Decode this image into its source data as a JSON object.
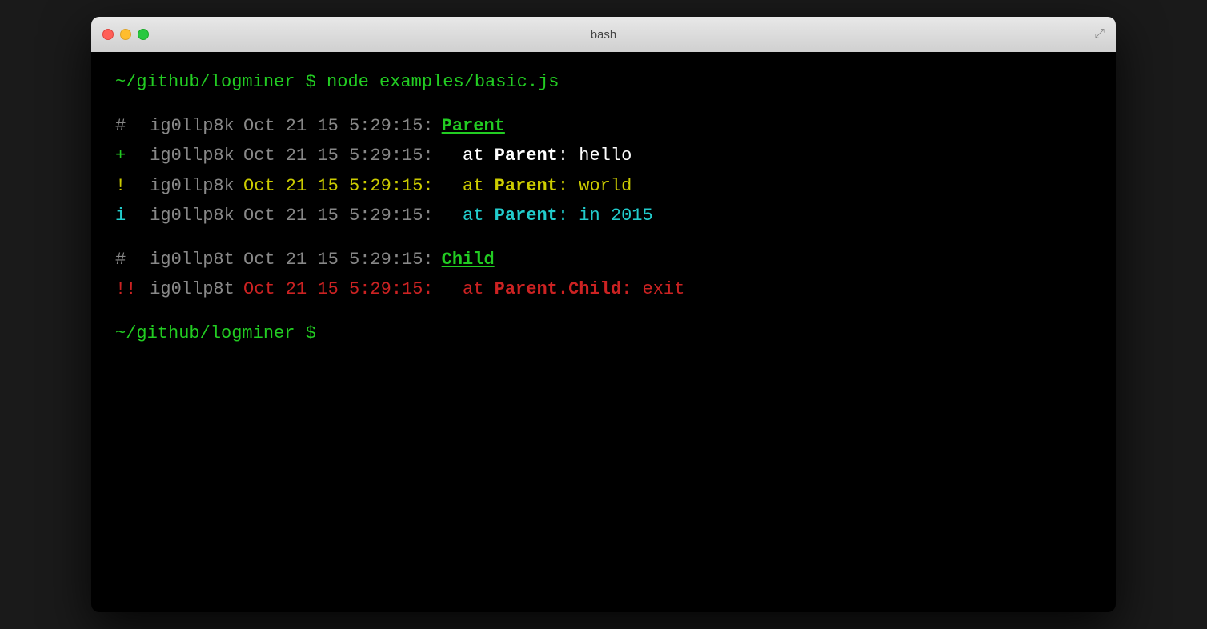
{
  "window": {
    "title": "bash",
    "buttons": {
      "close": "close",
      "minimize": "minimize",
      "maximize": "maximize"
    }
  },
  "terminal": {
    "command": "~/github/logminer $ node examples/basic.js",
    "prompt": "~/github/logminer $",
    "blocks": [
      {
        "lines": [
          {
            "prefix": "#",
            "prefix_class": "prefix-hash",
            "id": "ig0llp8k",
            "id_color": "gray",
            "timestamp": "Oct 21 15 5:29:15:",
            "timestamp_class": "ts-gray",
            "label": "Parent",
            "label_underline": true,
            "msg": null
          },
          {
            "prefix": "+",
            "prefix_class": "prefix-plus",
            "id": "ig0llp8k",
            "id_color": "gray",
            "timestamp": "Oct 21 15 5:29:15:",
            "timestamp_class": "ts-gray",
            "label": null,
            "msg": "  at Parent: hello",
            "msg_class": "msg-white"
          },
          {
            "prefix": "!",
            "prefix_class": "prefix-excl",
            "id": "ig0llp8k",
            "id_color": "gray",
            "timestamp": "Oct 21 15 5:29:15:",
            "timestamp_class": "ts-yellow",
            "label": null,
            "msg": "  at Parent: world",
            "msg_class": "msg-yellow"
          },
          {
            "prefix": "i",
            "prefix_class": "prefix-i",
            "id": "ig0llp8k",
            "id_color": "gray",
            "timestamp": "Oct 21 15 5:29:15:",
            "timestamp_class": "ts-gray",
            "label": null,
            "msg": "  at Parent: in 2015",
            "msg_class": "msg-cyan"
          }
        ]
      },
      {
        "lines": [
          {
            "prefix": "#",
            "prefix_class": "prefix-hash",
            "id": "ig0llp8t",
            "id_color": "gray",
            "timestamp": "Oct 21 15 5:29:15:",
            "timestamp_class": "ts-gray",
            "label": "Child",
            "label_underline": true,
            "msg": null
          },
          {
            "prefix": "!!",
            "prefix_class": "prefix-dblexcl",
            "id": "ig0llp8t",
            "id_color": "gray",
            "timestamp": "Oct 21 15 5:29:15:",
            "timestamp_class": "ts-red",
            "label": null,
            "msg": "  at Parent.Child: exit",
            "msg_class": "msg-red"
          }
        ]
      }
    ]
  }
}
